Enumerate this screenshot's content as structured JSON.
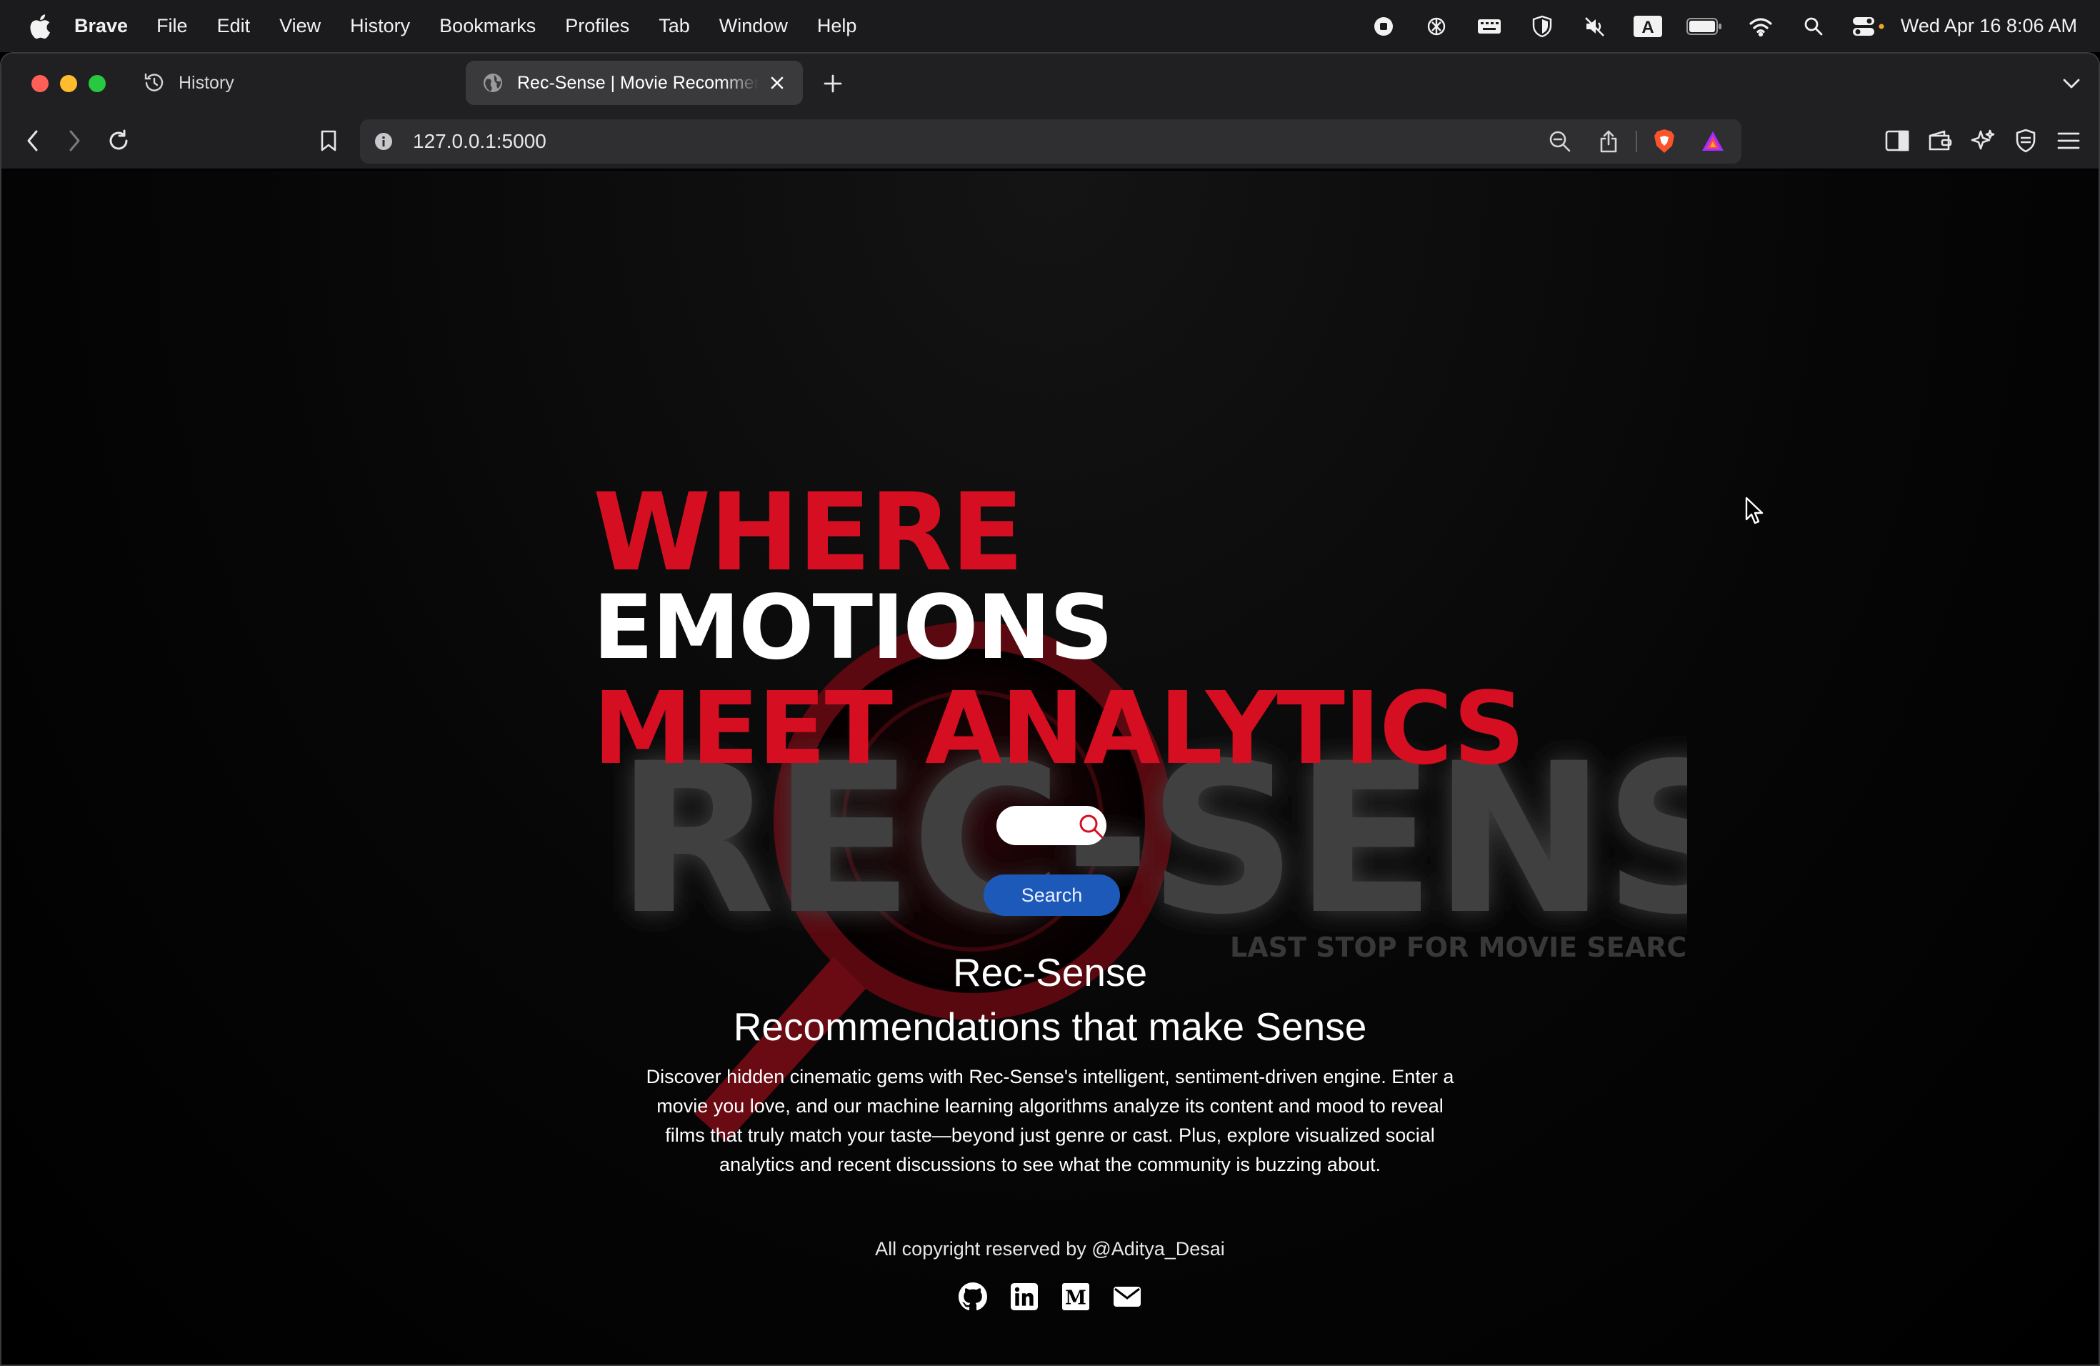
{
  "menubar": {
    "app_name": "Brave",
    "items": [
      "File",
      "Edit",
      "View",
      "History",
      "Bookmarks",
      "Profiles",
      "Tab",
      "Window",
      "Help"
    ],
    "clock": "Wed Apr 16  8:06 AM",
    "status_icons": [
      "record-icon",
      "chatgpt-icon",
      "keyboard-icon",
      "shield-icon",
      "mute-icon",
      "input-source-icon",
      "battery-icon",
      "wifi-icon",
      "spotlight-icon",
      "control-center-icon"
    ],
    "input_source_label": "A"
  },
  "tabs": [
    {
      "title": "History",
      "icon": "history-icon",
      "active": false
    },
    {
      "title": "Rec-Sense | Movie Recommender",
      "icon": "globe-icon",
      "active": true
    }
  ],
  "toolbar": {
    "url": "127.0.0.1:5000"
  },
  "hero": {
    "line1": "WHERE",
    "line2": "EMOTIONS",
    "line3": "MEET ANALYTICS"
  },
  "background_logo": {
    "word": "REC-SENSE",
    "tagline": "LAST STOP FOR MOVIE SEARCH"
  },
  "search": {
    "value": "",
    "placeholder": "",
    "button_label": "Search"
  },
  "brand": {
    "title": "Rec-Sense",
    "subtitle": "Recommendations that make Sense",
    "description": "Discover hidden cinematic gems with Rec-Sense's intelligent, sentiment-driven engine. Enter a movie you love, and our machine learning algorithms analyze its content and mood to reveal films that truly match your taste—beyond just genre or cast. Plus, explore visualized social analytics and recent discussions to see what the community is buzzing about."
  },
  "footer": {
    "copyright": "All copyright reserved by @Aditya_Desai",
    "socials": [
      "github-icon",
      "linkedin-icon",
      "medium-icon",
      "email-icon"
    ]
  },
  "colors": {
    "accent_red": "#d50e21",
    "button_blue": "#1d59b8",
    "background": "#000000"
  }
}
